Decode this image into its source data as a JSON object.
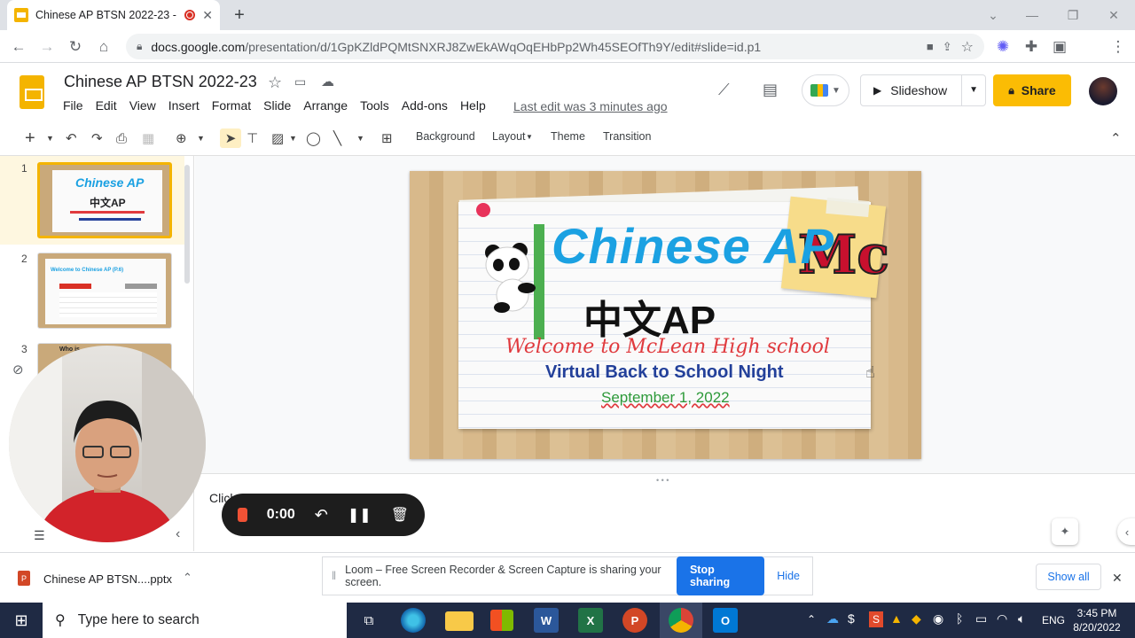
{
  "browser": {
    "tab_title": "Chinese AP BTSN 2022-23 - ",
    "url_host": "docs.google.com",
    "url_path": "/presentation/d/1GpKZldPQMtSNXRJ8ZwEkAWqOqEHbPp2Wh45SEOfTh9Y/edit#slide=id.p1"
  },
  "app": {
    "doc_title": "Chinese AP BTSN 2022-23",
    "menus": [
      "File",
      "Edit",
      "View",
      "Insert",
      "Format",
      "Slide",
      "Arrange",
      "Tools",
      "Add-ons",
      "Help"
    ],
    "last_edit": "Last edit was 3 minutes ago",
    "slideshow_label": "Slideshow",
    "share_label": "Share"
  },
  "toolbar": {
    "background": "Background",
    "layout": "Layout",
    "theme": "Theme",
    "transition": "Transition"
  },
  "filmstrip": {
    "slides": [
      {
        "num": "1",
        "title": "Chinese AP"
      },
      {
        "num": "2",
        "title": "Welcome to Chinese AP (P.6)"
      },
      {
        "num": "3",
        "title": "Who is ..."
      }
    ]
  },
  "slide": {
    "title": "Chinese AP",
    "title_cn": "中文AP",
    "welcome": "Welcome to McLean High school",
    "subtitle": "Virtual Back to School Night",
    "date": "September 1, 2022",
    "logo": "Mc"
  },
  "notes": {
    "placeholder": "Click to add speaker notes"
  },
  "loom": {
    "timer": "0:00",
    "banner": "Loom – Free Screen Recorder & Screen Capture is sharing your screen.",
    "stop_sharing": "Stop sharing",
    "hide": "Hide"
  },
  "downloads": {
    "file": "Chinese AP BTSN....pptx",
    "show_all": "Show all"
  },
  "taskbar": {
    "search_placeholder": "Type here to search",
    "lang": "ENG",
    "time": "3:45 PM",
    "date": "8/20/2022"
  },
  "colors": {
    "brand": "#f4b400",
    "share": "#fbbc04",
    "loom_accent": "#f05235",
    "link": "#1a73e8"
  }
}
